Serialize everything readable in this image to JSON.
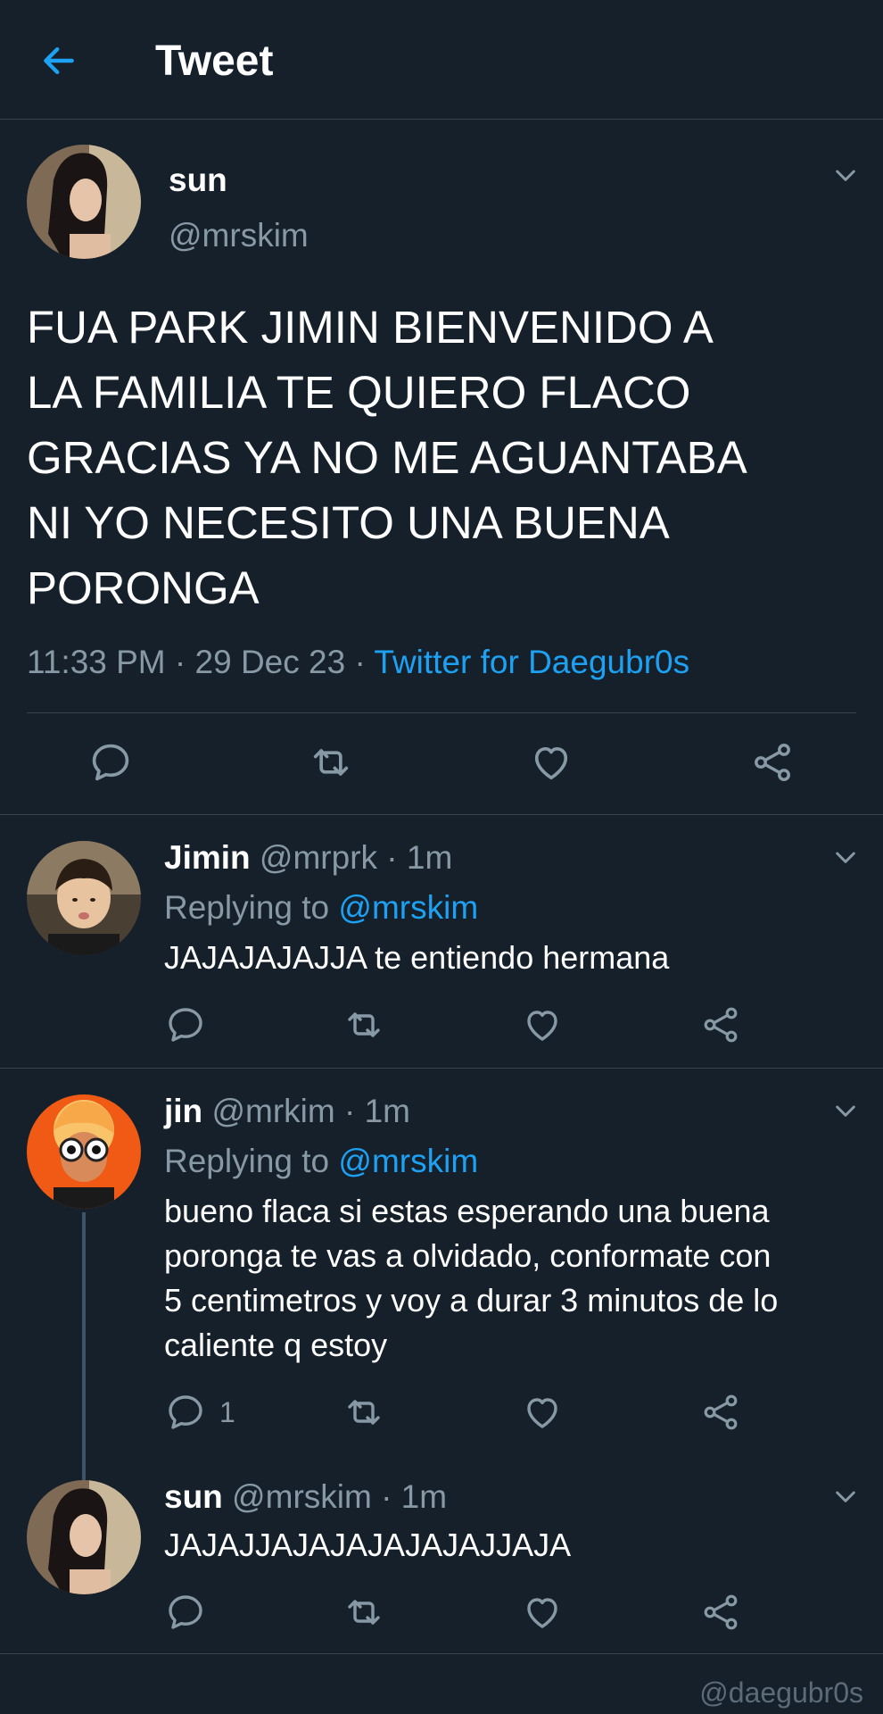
{
  "header": {
    "title": "Tweet"
  },
  "main_tweet": {
    "name": "sun",
    "handle": "@mrskim",
    "text": "FUA PARK JIMIN BIENVENIDO A\nLA FAMILIA TE QUIERO FLACO\nGRACIAS YA NO ME AGUANTABA\nNI YO NECESITO UNA BUENA\nPORONGA",
    "time": "11:33 PM · 29 Dec 23 · ",
    "source": "Twitter for Daegubr0s"
  },
  "replies": [
    {
      "name": "Jimin",
      "meta": " @mrprk · 1m",
      "replying_prefix": "Replying to ",
      "replying_to": "@mrskim",
      "text": "JAJAJAJAJJA te entiendo hermana",
      "reply_count": ""
    },
    {
      "name": "jin",
      "meta": " @mrkim · 1m",
      "replying_prefix": "Replying to ",
      "replying_to": "@mrskim",
      "text": "bueno flaca si estas esperando una buena\nporonga te vas a olvidado, conformate con\n5 centimetros y voy a durar 3 minutos de lo\ncaliente q estoy",
      "reply_count": "1"
    },
    {
      "name": "sun",
      "meta": " @mrskim · 1m",
      "text": "JAJAJJAJAJAJAJAJAJJAJA",
      "reply_count": ""
    }
  ],
  "icons": [
    "back-arrow-icon",
    "chevron-down-icon",
    "reply-icon",
    "retweet-icon",
    "like-icon",
    "share-icon"
  ],
  "watermark": "@daegubr0s",
  "colors": {
    "background": "#15202b",
    "accent": "#1da1f2",
    "muted_text": "#8899a6",
    "divider": "#38444d"
  }
}
